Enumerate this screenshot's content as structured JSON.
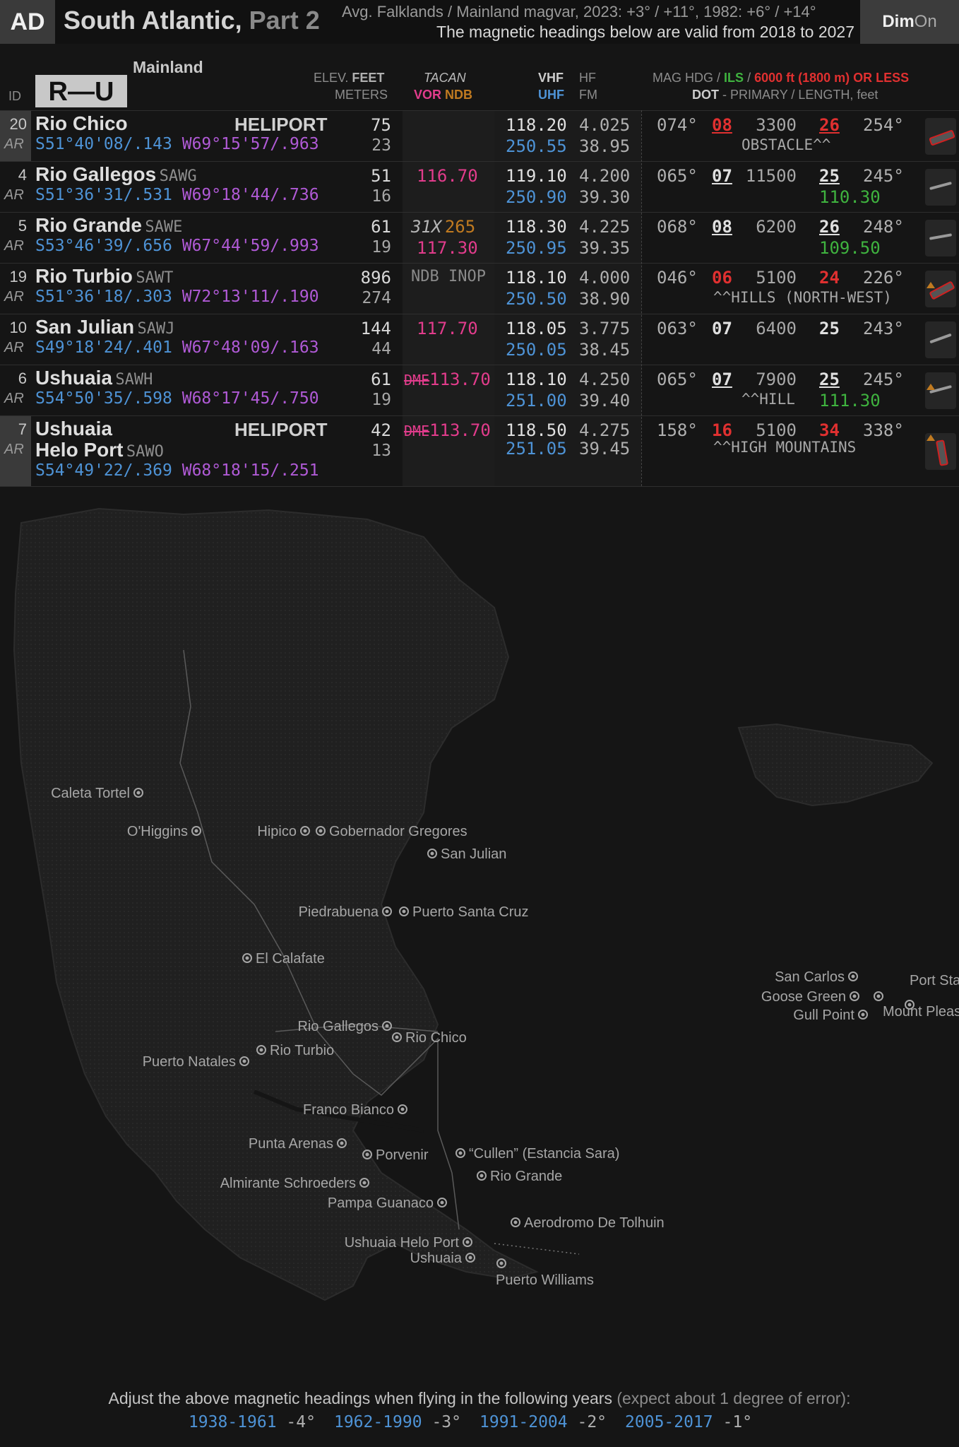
{
  "header": {
    "badge": "AD",
    "title": "South Atlantic,",
    "title_part": "Part 2",
    "magvar_line1": "Avg. Falklands / Mainland magvar, 2023: +3° / +11°, 1982: +6° / +14°",
    "magvar_line2": "The magnetic headings below are valid from 2018 to 2027",
    "dim": "Dim",
    "on": "On"
  },
  "columns": {
    "id": "ID",
    "mainland": "Mainland",
    "range": "R—U",
    "elev_feet_a": "ELEV.",
    "elev_feet_b": "FEET",
    "elev_meters": "METERS",
    "tacan": "TACAN",
    "vor": "VOR",
    "ndb": "NDB",
    "vhf": "VHF",
    "hf": "HF",
    "uhf": "UHF",
    "fm": "FM",
    "maghdg": "MAG HDG /",
    "ils": "ILS",
    "slash": "/",
    "short": "6000 ft (1800 m) OR LESS",
    "dot": "DOT",
    "primary": "- PRIMARY / LENGTH, feet"
  },
  "airfields": [
    {
      "id": "20",
      "ar": "AR",
      "name": "Rio Chico",
      "icao": "",
      "heli": "HELIPORT",
      "lat": "S51°40'08/.143",
      "lon": "W69°15'57/.963",
      "elev_ft": "75",
      "elev_m": "23",
      "vor": "",
      "ndb": "",
      "tacan": "",
      "tacan_x": "",
      "vhf": "118.20",
      "uhf": "250.55",
      "hf": "4.025",
      "fm": "38.95",
      "hdg1": "074°",
      "rwy1": "08",
      "len": "3300",
      "rwy2": "26",
      "hdg2": "254°",
      "ils": "",
      "note": "OBSTACLE^^",
      "red": true
    },
    {
      "id": "4",
      "ar": "AR",
      "name": "Rio Gallegos",
      "icao": "SAWG",
      "heli": "",
      "lat": "S51°36'31/.531",
      "lon": "W69°18'44/.736",
      "elev_ft": "51",
      "elev_m": "16",
      "vor": "116.70",
      "ndb": "",
      "tacan": "",
      "tacan_x": "",
      "vhf": "119.10",
      "uhf": "250.90",
      "hf": "4.200",
      "fm": "39.30",
      "hdg1": "065°",
      "rwy1": "07",
      "len": "11500",
      "rwy2": "25",
      "hdg2": "245°",
      "ils": "110.30",
      "note": "",
      "red": false
    },
    {
      "id": "5",
      "ar": "AR",
      "name": "Rio Grande",
      "icao": "SAWE",
      "heli": "",
      "lat": "S53°46'39/.656",
      "lon": "W67°44'59/.993",
      "elev_ft": "61",
      "elev_m": "19",
      "vor": "117.30",
      "ndb": "265",
      "tacan": "31X",
      "tacan_x": "",
      "vhf": "118.30",
      "uhf": "250.95",
      "hf": "4.225",
      "fm": "39.35",
      "hdg1": "068°",
      "rwy1": "08",
      "len": "6200",
      "rwy2": "26",
      "hdg2": "248°",
      "ils": "109.50",
      "note": "",
      "red": false
    },
    {
      "id": "19",
      "ar": "AR",
      "name": "Rio Turbio",
      "icao": "SAWT",
      "heli": "",
      "lat": "S51°36'18/.303",
      "lon": "W72°13'11/.190",
      "elev_ft": "896",
      "elev_m": "274",
      "vor": "",
      "ndb": "",
      "tacan": "NDB INOP",
      "tacan_x": "",
      "vhf": "118.10",
      "uhf": "250.50",
      "hf": "4.000",
      "fm": "38.90",
      "hdg1": "046°",
      "rwy1": "06",
      "len": "5100",
      "rwy2": "24",
      "hdg2": "226°",
      "ils": "",
      "note": "^^HILLS (NORTH-WEST)",
      "red": true
    },
    {
      "id": "10",
      "ar": "AR",
      "name": "San Julian",
      "icao": "SAWJ",
      "heli": "",
      "lat": "S49°18'24/.401",
      "lon": "W67°48'09/.163",
      "elev_ft": "144",
      "elev_m": "44",
      "vor": "117.70",
      "ndb": "",
      "tacan": "",
      "tacan_x": "",
      "vhf": "118.05",
      "uhf": "250.05",
      "hf": "3.775",
      "fm": "38.45",
      "hdg1": "063°",
      "rwy1": "07",
      "len": "6400",
      "rwy2": "25",
      "hdg2": "243°",
      "ils": "",
      "note": "",
      "red": false
    },
    {
      "id": "6",
      "ar": "AR",
      "name": "Ushuaia",
      "icao": "SAWH",
      "heli": "",
      "lat": "S54°50'35/.598",
      "lon": "W68°17'45/.750",
      "elev_ft": "61",
      "elev_m": "19",
      "vor": "113.70",
      "ndb": "",
      "tacan": "DME",
      "tacan_x": "",
      "vhf": "118.10",
      "uhf": "251.00",
      "hf": "4.250",
      "fm": "39.40",
      "hdg1": "065°",
      "rwy1": "07",
      "len": "7900",
      "rwy2": "25",
      "hdg2": "245°",
      "ils": "111.30",
      "note": "^^HILL",
      "red": false
    },
    {
      "id": "7",
      "ar": "AR",
      "name": "Ushuaia",
      "name2": "Helo Port",
      "icao": "SAWO",
      "heli": "HELIPORT",
      "lat": "S54°49'22/.369",
      "lon": "W68°18'15/.251",
      "elev_ft": "42",
      "elev_m": "13",
      "vor": "113.70",
      "ndb": "",
      "tacan": "DME",
      "tacan_x": "",
      "vhf": "118.50",
      "uhf": "251.05",
      "hf": "4.275",
      "fm": "39.45",
      "hdg1": "158°",
      "rwy1": "16",
      "len": "5100",
      "rwy2": "34",
      "hdg2": "338°",
      "ils": "",
      "note": "^^HIGH MOUNTAINS",
      "red": true
    }
  ],
  "map_labels": [
    "Caleta Tortel",
    "O'Higgins",
    "Hipico",
    "Gobernador Gregores",
    "San Julian",
    "Piedrabuena",
    "Puerto Santa Cruz",
    "El Calafate",
    "Rio Gallegos",
    "Rio Chico",
    "Rio Turbio",
    "Puerto Natales",
    "Franco Bianco",
    "Punta Arenas",
    "Porvenir",
    "“Cullen” (Estancia Sara)",
    "Rio Grande",
    "Almirante Schroeders",
    "Pampa Guanaco",
    "Aerodromo De Tolhuin",
    "Ushuaia Helo Port",
    "Ushuaia",
    "Puerto Williams",
    "San Carlos",
    "Goose Green",
    "Gull Point",
    "Port Stanley",
    "Mount Pleasant"
  ],
  "footer": {
    "line1": "Adjust the above magnetic headings when flying in the following years",
    "line1_soft": "(expect about 1 degree of error):",
    "years": [
      {
        "range": "1938-1961",
        "delta": "-4°"
      },
      {
        "range": "1962-1990",
        "delta": "-3°"
      },
      {
        "range": "1991-2004",
        "delta": "-2°"
      },
      {
        "range": "2005-2017",
        "delta": "-1°"
      }
    ]
  },
  "colors": {
    "lat": "#4e93d6",
    "lon": "#b05ad6",
    "vor": "#e23c8c",
    "ndb": "#c07a20",
    "ils": "#3fb33f",
    "short": "#e03030"
  }
}
